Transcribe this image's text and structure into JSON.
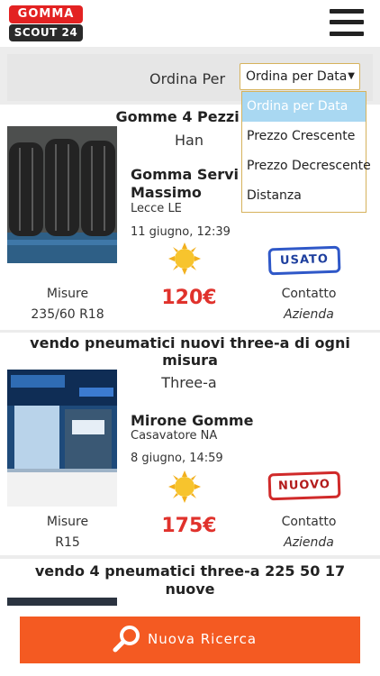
{
  "header": {
    "logo_top": "GOMMA",
    "logo_bottom": "SCOUT 24",
    "menu_icon": "hamburger-menu-icon"
  },
  "sort": {
    "label": "Ordina Per",
    "selected": "Ordina per Data",
    "options": [
      "Ordina per Data",
      "Prezzo Crescente",
      "Prezzo Decrescente",
      "Distanza"
    ]
  },
  "listings": [
    {
      "title": "Gomme 4 Pezzi 12",
      "brand": "Han",
      "seller": "Gomma Servi",
      "seller_line2": "Massimo",
      "city": "Lecce LE",
      "date": "11 giugno, 12:39",
      "badge": "USATO",
      "measures_label": "Misure",
      "measures_value": "235/60 R18",
      "price": "120€",
      "contact_label": "Contatto",
      "contact_value": "Azienda"
    },
    {
      "title_line1": "vendo pneumatici nuovi three-a di ogni",
      "title_line2": "misura",
      "brand": "Three-a",
      "seller": "Mirone Gomme",
      "city": "Casavatore NA",
      "date": "8 giugno, 14:59",
      "badge": "NUOVO",
      "measures_label": "Misure",
      "measures_value": "R15",
      "price": "175€",
      "contact_label": "Contatto",
      "contact_value": "Azienda"
    },
    {
      "title_line1": "vendo 4 pneumatici three-a 225 50 17",
      "title_line2": "nuove"
    }
  ],
  "footer": {
    "button_label": "Nuova Ricerca"
  },
  "colors": {
    "accent": "#f45a22",
    "price": "#e0322c",
    "logo_red": "#e32222",
    "dropdown_selected": "#a9d8f2"
  }
}
